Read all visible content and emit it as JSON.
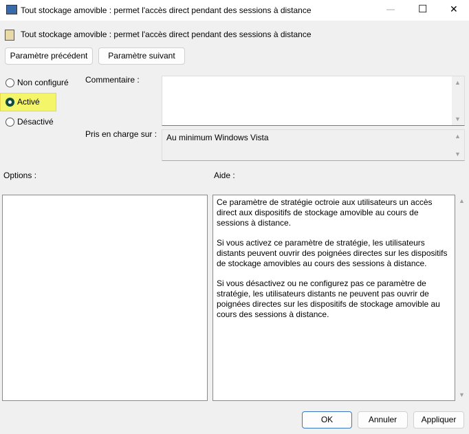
{
  "window": {
    "title": "Tout stockage amovible : permet l'accès direct pendant des sessions à distance",
    "minimize": "—",
    "maximize": "☐",
    "close": "✕"
  },
  "header": {
    "title": "Tout stockage amovible : permet l'accès direct pendant des sessions à distance"
  },
  "nav": {
    "prev": "Paramètre précédent",
    "next": "Paramètre suivant"
  },
  "state": {
    "options": [
      "Non configuré",
      "Activé",
      "Désactivé"
    ],
    "selected": "Activé"
  },
  "comment": {
    "label": "Commentaire :",
    "value": ""
  },
  "supported": {
    "label": "Pris en charge sur :",
    "value": "Au minimum Windows Vista"
  },
  "options_label": "Options :",
  "help_label": "Aide :",
  "help": [
    "Ce paramètre de stratégie octroie aux utilisateurs un accès direct aux dispositifs de stockage amovible au cours de sessions à distance.",
    "Si vous activez ce paramètre de stratégie, les utilisateurs distants peuvent ouvrir des poignées directes sur les dispositifs de stockage amovibles au cours des sessions à distance.",
    "Si vous désactivez ou ne configurez pas ce paramètre de stratégie, les utilisateurs distants ne peuvent pas ouvrir de poignées directes sur les dispositifs de stockage amovible au cours des sessions à distance."
  ],
  "buttons": {
    "ok": "OK",
    "cancel": "Annuler",
    "apply": "Appliquer"
  },
  "colors": {
    "highlight": "#f5f56a",
    "radio": "#0f4d3a"
  }
}
